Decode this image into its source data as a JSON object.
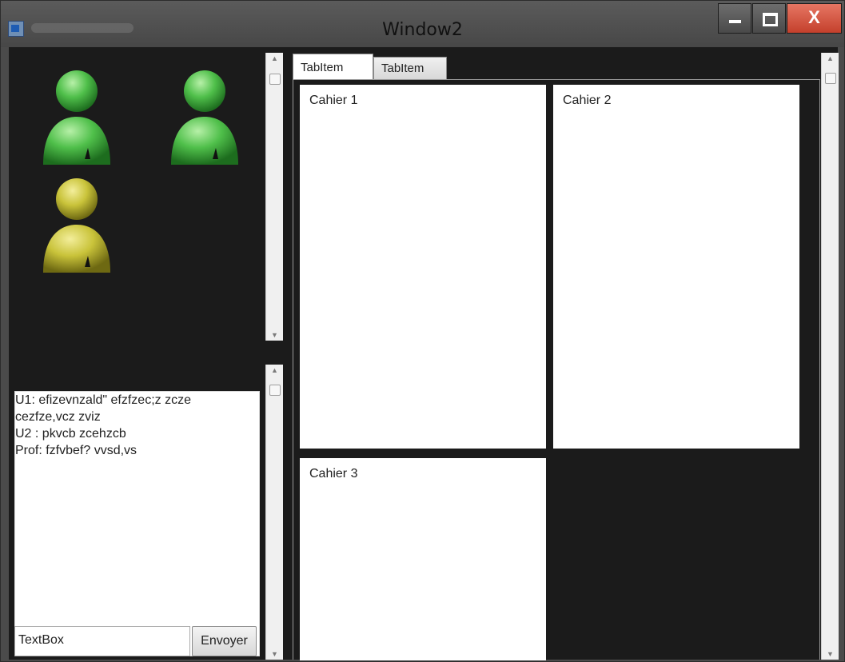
{
  "window": {
    "title": "Window2",
    "close_glyph": "X"
  },
  "users": {
    "avatars": [
      {
        "name": "user-green-icon",
        "color": "#4fbf4a"
      },
      {
        "name": "user-green-icon",
        "color": "#4fbf4a"
      },
      {
        "name": "user-yellow-icon",
        "color": "#c9c33a"
      }
    ]
  },
  "chat": {
    "lines": [
      " U1: efizevnzald\" efzfzec;z zcze",
      "cezfze,vcz zviz",
      " U2 : pkvcb zcehzcb",
      " Prof: fzfvbef? vvsd,vs"
    ],
    "input_value": "TextBox",
    "send_label": "Envoyer"
  },
  "tabs": [
    {
      "label": "TabItem",
      "selected": true
    },
    {
      "label": "TabItem",
      "selected": false
    }
  ],
  "cards": [
    "Cahier 1",
    "Cahier 2",
    "Cahier 3"
  ]
}
